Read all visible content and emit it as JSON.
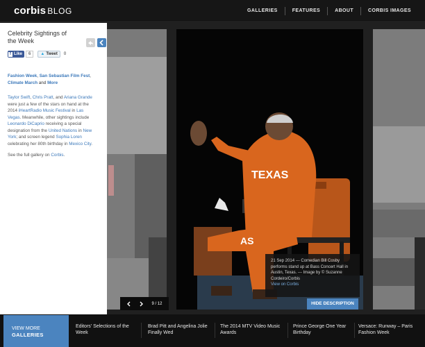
{
  "header": {
    "logo_part1": "corbis",
    "logo_part2": "BLOG",
    "nav": [
      "GALLERIES",
      "FEATURES",
      "ABOUT",
      "CORBIS IMAGES"
    ]
  },
  "sidebar": {
    "post_title": "Celebrity Sightings of the Week",
    "like_label": "Like",
    "like_count": "6",
    "tweet_label": "Tweet",
    "tweet_count": "0",
    "tags": {
      "tag1": "Fashion Week",
      "tag2": "San Sebastian Film Fest",
      "tag3": "Climate March",
      "and": "and",
      "more": "More"
    },
    "body": {
      "p1": "Taylor Swift",
      "p2": "Chris Pratt",
      "p3": "and",
      "p4": "Ariana Grande",
      "p5": "were just a few of the stars on hand at the 2014",
      "p6": "iHeartRadio Music Festival",
      "p7": "in",
      "p8": "Las Vegas",
      "p9": ". Meanwhile, other sightings include",
      "p10": "Leonardo DiCaprio",
      "p11": "receiving a special designation from the",
      "p12": "United Nations",
      "p13": "in",
      "p14": "New York",
      "p15": "; and screen legend",
      "p16": "Sophia Loren",
      "p17": "celebrating her 80th birthday in",
      "p18": "Mexico City",
      "p19": "."
    },
    "gallery_note_prefix": "See the full gallery on",
    "gallery_note_link": "Corbis",
    "gallery_note_suffix": "."
  },
  "gallery": {
    "caption": "21 Sep 2014 --- Comedian Bill Cosby performs stand up at Bass Concert Hall in Austin, Texas. --- Image by © Suzanne Cordeiro/Corbis",
    "caption_link": "View on Corbis",
    "hide_label": "HIDE DESCRIPTION",
    "pager": "9 / 12",
    "hoodie_text": "TEXAS",
    "pants_text": "AS"
  },
  "footer": {
    "view_more_line1": "VIEW MORE",
    "view_more_line2": "GALLERIES",
    "items": [
      "Editors' Selections of the Week",
      "Brad Pitt and Angelina Jolie Finally Wed",
      "The 2014 MTV Video Music Awards",
      "Prince George One Year Birthday",
      "Versace: Runway – Paris Fashion Week"
    ]
  },
  "colors": {
    "accent": "#4b84bf",
    "link": "#3b78ba",
    "header_bg": "#161616",
    "hoodie_orange": "#d9661e"
  }
}
